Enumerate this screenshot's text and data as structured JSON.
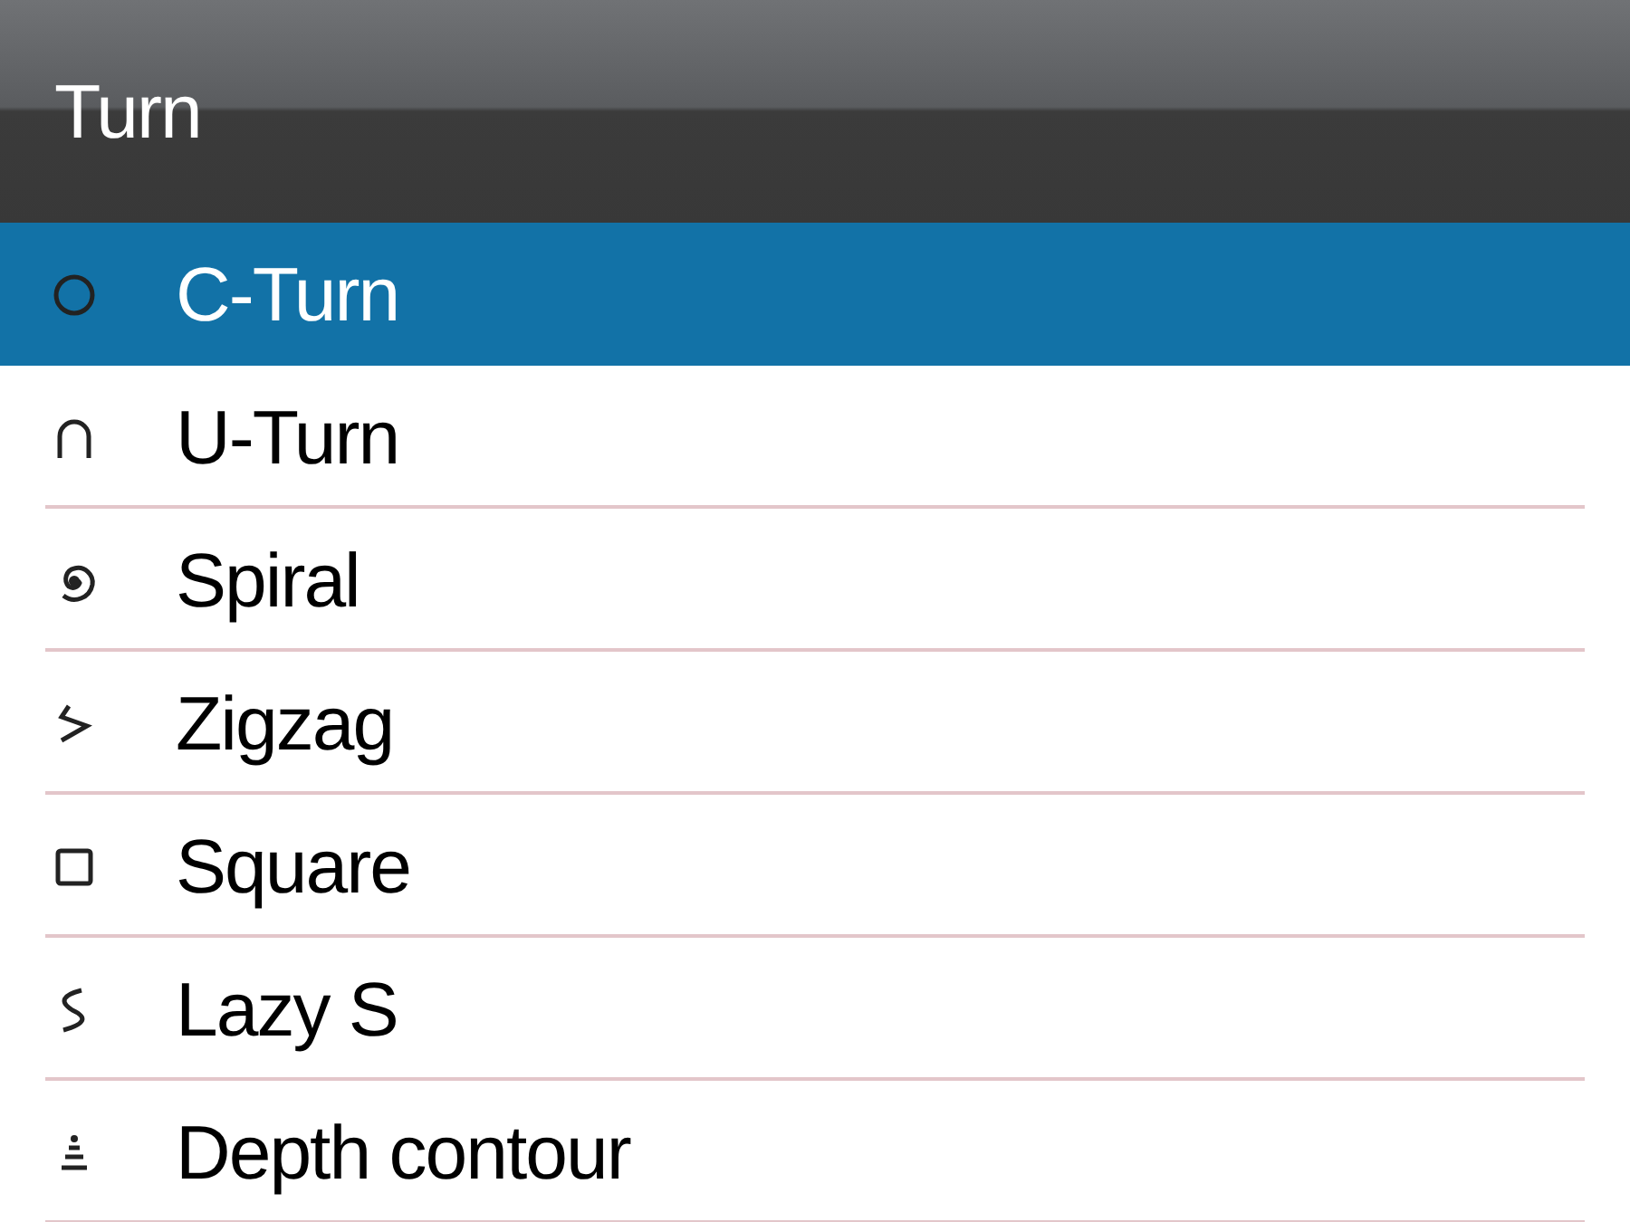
{
  "header": {
    "title": "Turn"
  },
  "items": [
    {
      "label": "C-Turn",
      "kind": "circle",
      "selected": true
    },
    {
      "label": "U-Turn",
      "kind": "u",
      "selected": false
    },
    {
      "label": "Spiral",
      "kind": "spiral",
      "selected": false
    },
    {
      "label": "Zigzag",
      "kind": "zigzag",
      "selected": false
    },
    {
      "label": "Square",
      "kind": "square",
      "selected": false
    },
    {
      "label": "Lazy S",
      "kind": "lazys",
      "selected": false
    },
    {
      "label": "Depth contour",
      "kind": "depth",
      "selected": false
    }
  ]
}
